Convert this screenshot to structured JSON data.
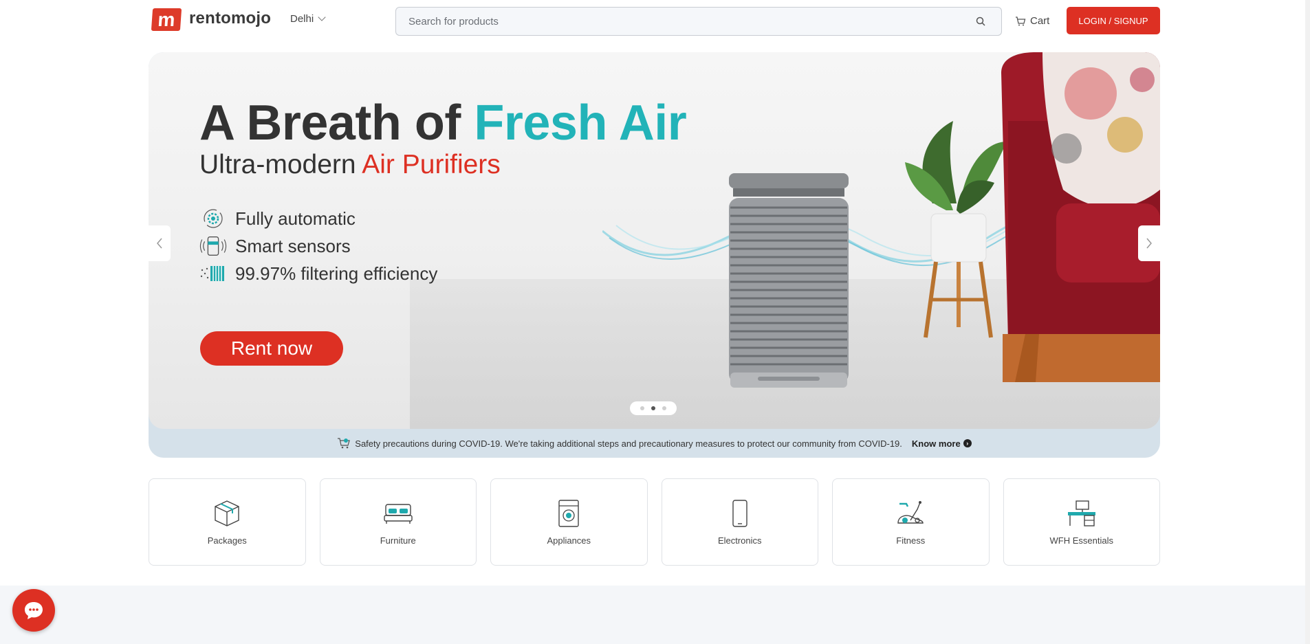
{
  "header": {
    "logo_mark": "m",
    "logo_text": "rentomojo",
    "city": "Delhi",
    "search_placeholder": "Search for products",
    "cart_label": "Cart",
    "login_label": "LOGIN / SIGNUP"
  },
  "banner": {
    "headline_part1": "A Breath of ",
    "headline_accent": "Fresh Air",
    "subline_part1": "Ultra-modern ",
    "subline_accent": "Air Purifiers",
    "features": [
      {
        "label": "Fully automatic",
        "icon": "gear-cycle-icon"
      },
      {
        "label": "Smart sensors",
        "icon": "sensor-icon"
      },
      {
        "label": "99.97% filtering efficiency",
        "icon": "filter-icon"
      }
    ],
    "cta_label": "Rent now",
    "carousel_active_index": 1,
    "carousel_count": 3
  },
  "covid_notice": {
    "text": "Safety precautions during COVID-19. We're taking additional steps and precautionary measures to protect our community from COVID-19.",
    "link_label": "Know more"
  },
  "categories": [
    {
      "label": "Packages",
      "icon": "package-box-icon"
    },
    {
      "label": "Furniture",
      "icon": "bed-icon"
    },
    {
      "label": "Appliances",
      "icon": "washing-machine-icon"
    },
    {
      "label": "Electronics",
      "icon": "smartphone-icon"
    },
    {
      "label": "Fitness",
      "icon": "exercise-bike-icon"
    },
    {
      "label": "WFH Essentials",
      "icon": "desk-icon"
    }
  ],
  "colors": {
    "brand_red": "#dd3023",
    "accent_teal": "#22b3b8",
    "notice_bg": "#d5e1ea"
  }
}
